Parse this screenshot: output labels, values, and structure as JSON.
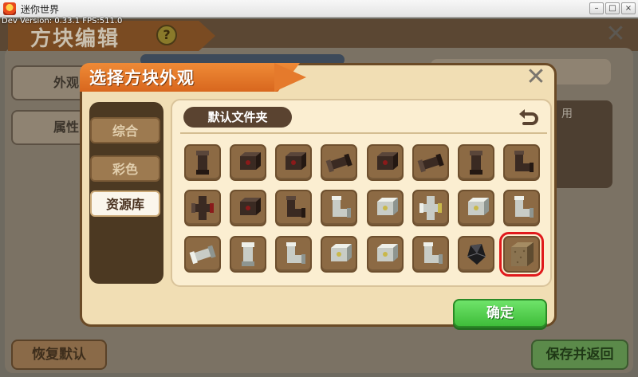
{
  "window": {
    "title": "迷你世界",
    "dev_info": "Dev Version: 0.33.1      FPS:511.0",
    "buttons": [
      "▢",
      "▢",
      "✕"
    ]
  },
  "background": {
    "title": "方块编辑",
    "help_label": "?",
    "tabs": [
      "外观",
      "属性"
    ],
    "right_text": "用",
    "restore_button": "恢复默认",
    "save_button": "保存并返回"
  },
  "dialog": {
    "title": "选择方块外观",
    "sidebar": [
      {
        "label": "综合",
        "active": false
      },
      {
        "label": "彩色",
        "active": false
      },
      {
        "label": "资源库",
        "active": true
      }
    ],
    "folder": "默认文件夹",
    "selected_slot": 23,
    "blocks": [
      {
        "kind": "pipe-v",
        "theme": "dark"
      },
      {
        "kind": "pipe-box",
        "theme": "dark"
      },
      {
        "kind": "pipe-box",
        "theme": "dark"
      },
      {
        "kind": "pipe-h",
        "theme": "dark"
      },
      {
        "kind": "pipe-box",
        "theme": "dark"
      },
      {
        "kind": "pipe-h",
        "theme": "dark"
      },
      {
        "kind": "pipe-v",
        "theme": "dark"
      },
      {
        "kind": "pipe-elbow",
        "theme": "dark"
      },
      {
        "kind": "pipe-tee",
        "theme": "dark"
      },
      {
        "kind": "pipe-box",
        "theme": "dark"
      },
      {
        "kind": "pipe-elbow",
        "theme": "dark"
      },
      {
        "kind": "pipe-elbow",
        "theme": "light"
      },
      {
        "kind": "pipe-box",
        "theme": "light"
      },
      {
        "kind": "pipe-tee",
        "theme": "light"
      },
      {
        "kind": "pipe-box",
        "theme": "light"
      },
      {
        "kind": "pipe-elbow",
        "theme": "light"
      },
      {
        "kind": "pipe-h",
        "theme": "light"
      },
      {
        "kind": "pipe-v",
        "theme": "light"
      },
      {
        "kind": "pipe-elbow",
        "theme": "light"
      },
      {
        "kind": "pipe-box",
        "theme": "light"
      },
      {
        "kind": "pipe-box",
        "theme": "light"
      },
      {
        "kind": "pipe-elbow",
        "theme": "light"
      },
      {
        "kind": "gem",
        "theme": "black"
      },
      {
        "kind": "cube",
        "theme": "wood"
      }
    ],
    "confirm_button": "确定"
  },
  "colors": {
    "orange_ribbon": "#e57a2c",
    "confirm_green": "#4cc946",
    "selection_red": "#e0191c",
    "slot_brown": "#8c6a44"
  }
}
